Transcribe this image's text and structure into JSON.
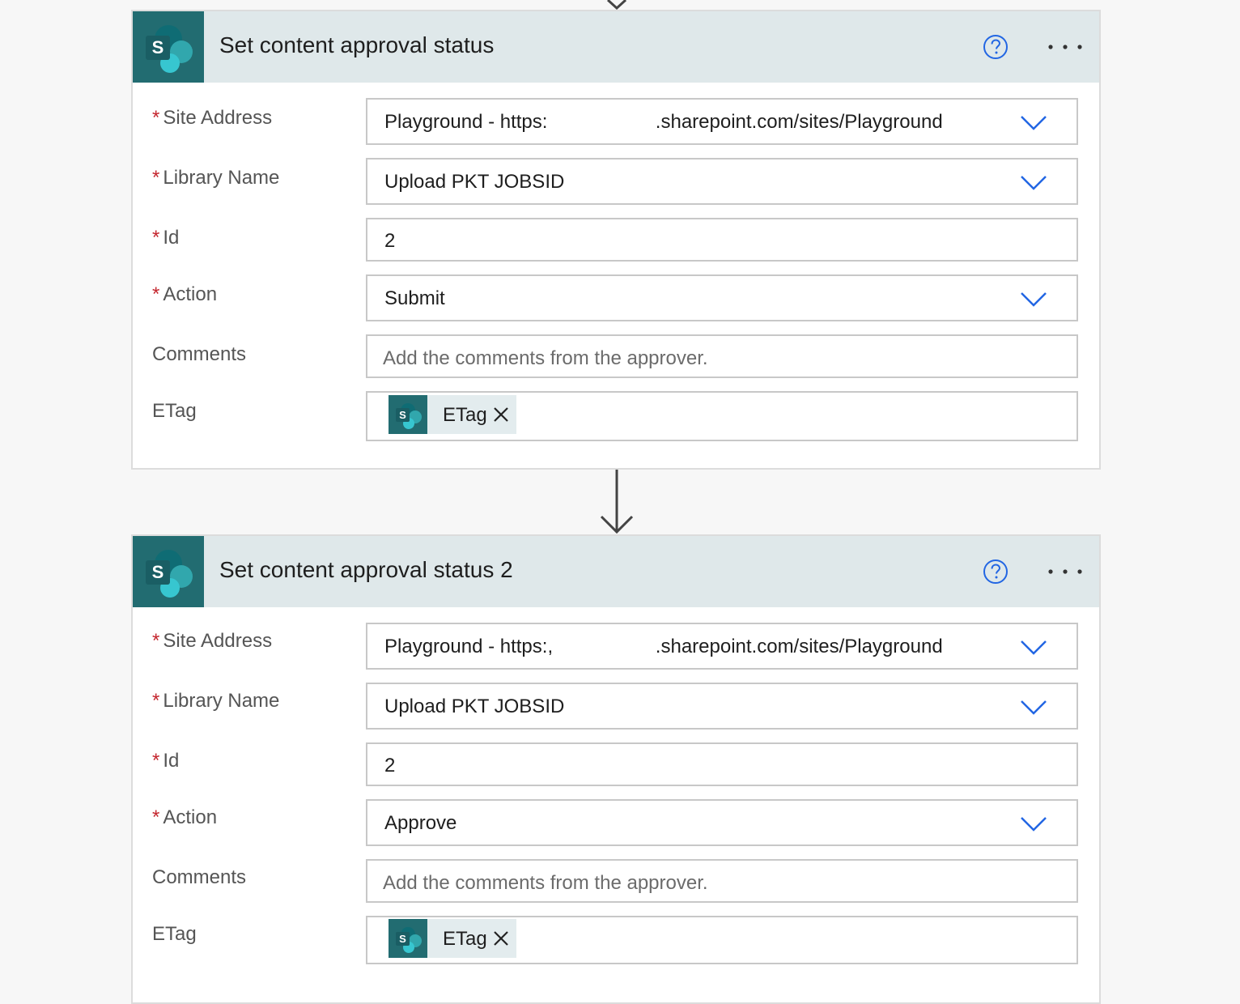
{
  "cards": [
    {
      "title": "Set content approval status",
      "fields": {
        "site_address": {
          "label": "Site Address",
          "value": "Playground - https:                    .sharepoint.com/sites/Playground"
        },
        "library_name": {
          "label": "Library Name",
          "value": "Upload PKT JOBSID"
        },
        "id": {
          "label": "Id",
          "value": "2"
        },
        "action": {
          "label": "Action",
          "value": "Submit"
        },
        "comments": {
          "label": "Comments",
          "placeholder": "Add the comments from the approver."
        },
        "etag": {
          "label": "ETag",
          "token": "ETag"
        }
      }
    },
    {
      "title": "Set content approval status 2",
      "fields": {
        "site_address": {
          "label": "Site Address",
          "value": "Playground - https:,                   .sharepoint.com/sites/Playground"
        },
        "library_name": {
          "label": "Library Name",
          "value": "Upload PKT JOBSID"
        },
        "id": {
          "label": "Id",
          "value": "2"
        },
        "action": {
          "label": "Action",
          "value": "Approve"
        },
        "comments": {
          "label": "Comments",
          "placeholder": "Add the comments from the approver."
        },
        "etag": {
          "label": "ETag",
          "token": "ETag"
        }
      }
    }
  ],
  "icons": {
    "connector": "sharepoint-icon",
    "help": "help-icon",
    "more": "more-options-icon",
    "chevron": "chevron-down-icon",
    "remove": "close-icon",
    "flow_arrow": "arrow-down-icon"
  },
  "colors": {
    "header_bg": "#dfe8ea",
    "brand": "#226c71",
    "accent": "#2266e3",
    "required": "#c4262e"
  }
}
